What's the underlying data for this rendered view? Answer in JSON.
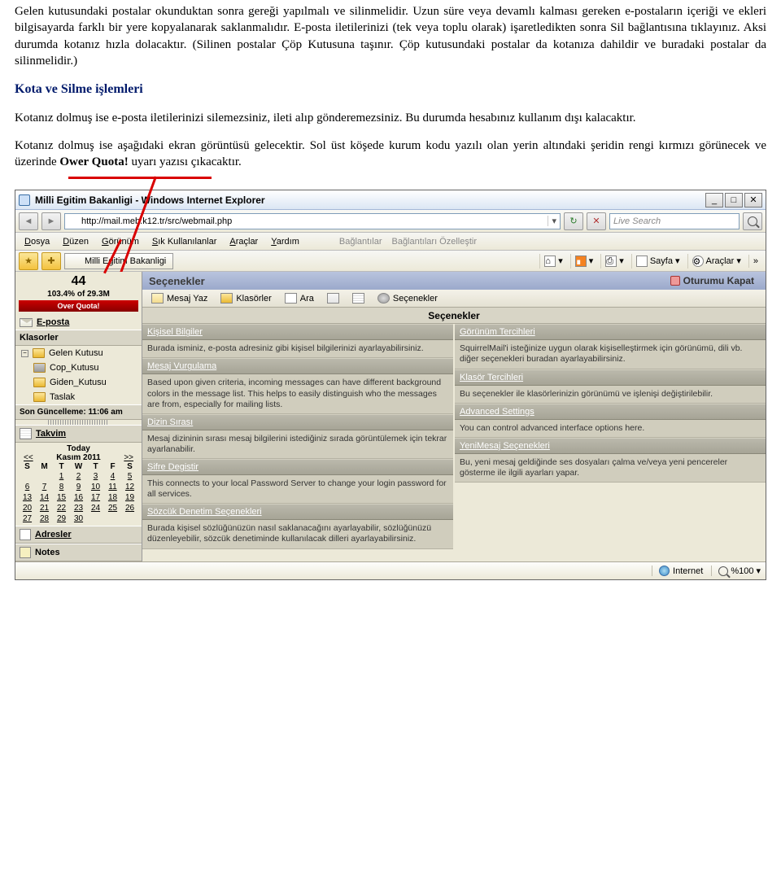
{
  "doc": {
    "p1": "Gelen kutusundaki postalar okunduktan sonra gereği yapılmalı ve silinmelidir. Uzun süre veya devamlı kalması gereken e-postaların içeriği ve ekleri bilgisayarda farklı bir yere kopyalanarak saklanmalıdır. E-posta iletilerinizi (tek veya toplu olarak) işaretledikten sonra Sil bağlantısına tıklayınız. Aksi durumda kotanız hızla dolacaktır. (Silinen postalar Çöp Kutusuna taşınır. Çöp kutusundaki postalar da kotanıza dahildir ve buradaki postalar da silinmelidir.)",
    "h1": "Kota ve Silme işlemleri",
    "p2a": "Kotanız dolmuş ise e-posta iletilerinizi silemezsiniz, ileti alıp gönderemezsiniz. Bu durumda hesabınız kullanım dışı kalacaktır.",
    "p3a": "Kotanız dolmuş ise aşağıdaki ekran görüntüsü gelecektir. Sol üst köşede kurum kodu yazılı olan yerin altındaki şeridin rengi kırmızı görünecek ve üzerinde ",
    "p3b": "Ower Quota!",
    "p3c": " uyarı yazısı çıkacaktır."
  },
  "ie": {
    "title": "Milli Egitim Bakanligi - Windows Internet Explorer",
    "url": "http://mail.meb.k12.tr/src/webmail.php",
    "search_ph": "Live Search",
    "menu": [
      "Dosya",
      "Düzen",
      "Görünüm",
      "Sık Kullanılanlar",
      "Araçlar",
      "Yardım"
    ],
    "links_lbl": "Bağlantılar",
    "links_cust": "Bağlantıları Özelleştir",
    "tab": "Milli Egitim Bakanligi",
    "tool_page": "Sayfa",
    "tool_tools": "Araçlar"
  },
  "left": {
    "code": "44",
    "quota": "103.4% of 29.3M",
    "overq": "Over Quota!",
    "eposta": "E-posta",
    "klasorler": "Klasorler",
    "gelen": "Gelen Kutusu",
    "cop": "Cop_Kutusu",
    "giden": "Giden_Kutusu",
    "taslak": "Taslak",
    "son": "Son Güncelleme: 11:06 am",
    "takvim": "Takvim",
    "today": "Today",
    "month": "Kasım 2011",
    "prev": "<<",
    "next": ">>",
    "days": [
      "S",
      "M",
      "T",
      "W",
      "T",
      "F",
      "S"
    ],
    "weeks": [
      [
        "",
        "",
        "1",
        "2",
        "3",
        "4",
        "5"
      ],
      [
        "6",
        "7",
        "8",
        "9",
        "10",
        "11",
        "12"
      ],
      [
        "13",
        "14",
        "15",
        "16",
        "17",
        "18",
        "19"
      ],
      [
        "20",
        "21",
        "22",
        "23",
        "24",
        "25",
        "26"
      ],
      [
        "27",
        "28",
        "29",
        "30",
        "",
        "",
        ""
      ]
    ],
    "adresler": "Adresler",
    "notes": "Notes"
  },
  "right": {
    "title": "Seçenekler",
    "logout": "Oturumu Kapat",
    "tb": {
      "yaz": "Mesaj Yaz",
      "klas": "Klasörler",
      "ara": "Ara",
      "sec": "Seçenekler"
    },
    "sub": "Seçenekler",
    "opts_left": [
      {
        "t": "Kişisel Bilgiler",
        "d": "Burada isminiz, e-posta adresiniz gibi kişisel bilgilerinizi ayarlayabilirsiniz."
      },
      {
        "t": "Mesaj Vurgulama",
        "d": "Based upon given criteria, incoming messages can have different background colors in the message list. This helps to easily distinguish who the messages are from, especially for mailing lists."
      },
      {
        "t": "Dizin Sırası",
        "d": "Mesaj dizininin sırası mesaj bilgilerini istediğiniz sırada görüntülemek için tekrar ayarlanabilir."
      },
      {
        "t": "Sifre Degistir",
        "d": "This connects to your local Password Server to change your login password for all services."
      },
      {
        "t": "Sözcük Denetim Seçenekleri",
        "d": "Burada kişisel sözlüğünüzün nasıl saklanacağını ayarlayabilir, sözlüğünüzü düzenleyebilir, sözcük denetiminde kullanılacak dilleri ayarlayabilirsiniz."
      }
    ],
    "opts_right": [
      {
        "t": "Görünüm Tercihleri",
        "d": "SquirrelMail'i isteğinize uygun olarak kişiselleştirmek için görünümü, dili vb. diğer seçenekleri buradan ayarlayabilirsiniz."
      },
      {
        "t": "Klasör Tercihleri",
        "d": "Bu seçenekler ile klasörlerinizin görünümü ve işlenişi değiştirilebilir."
      },
      {
        "t": "Advanced Settings",
        "d": "You can control advanced interface options here."
      },
      {
        "t": "YeniMesaj Seçenekleri",
        "d": "Bu, yeni mesaj geldiğinde ses dosyaları çalma ve/veya yeni pencereler gösterme ile ilgili ayarları yapar."
      }
    ]
  },
  "status": {
    "zone": "Internet",
    "zoom": "%100"
  }
}
